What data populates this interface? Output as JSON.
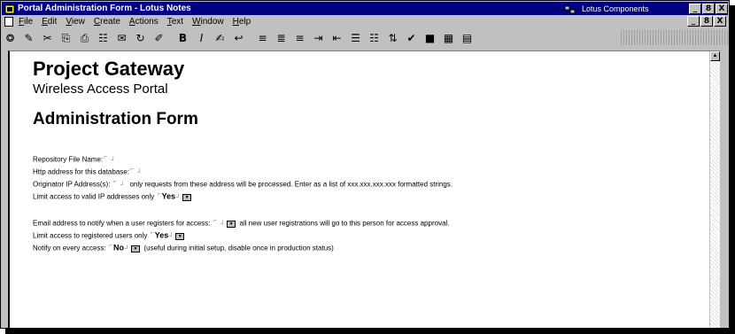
{
  "window": {
    "title": "Portal Administration Form - Lotus Notes",
    "components_label": "Lotus Components",
    "buttons": {
      "minimize": "_",
      "restore": "8",
      "close": "X"
    }
  },
  "menubar": {
    "items": [
      "File",
      "Edit",
      "View",
      "Create",
      "Actions",
      "Text",
      "Window",
      "Help"
    ],
    "buttons": {
      "minimize": "_",
      "restore": "8",
      "close": "X"
    }
  },
  "toolbar": {
    "items": [
      {
        "name": "navigator-icon",
        "glyph": "⭗"
      },
      {
        "name": "edit-doc-icon",
        "glyph": "✎"
      },
      {
        "name": "cut-icon",
        "glyph": "✂"
      },
      {
        "name": "copy-icon",
        "glyph": "⎘"
      },
      {
        "name": "paste-icon",
        "glyph": "⎙"
      },
      {
        "name": "table-icon",
        "glyph": "☷"
      },
      {
        "name": "send-icon",
        "glyph": "✉"
      },
      {
        "name": "refresh-icon",
        "glyph": "↻"
      },
      {
        "name": "attach-icon",
        "glyph": "✐"
      },
      {
        "name": "bold-icon",
        "glyph": "B"
      },
      {
        "name": "italic-icon",
        "glyph": "I"
      },
      {
        "name": "highlight-icon",
        "glyph": "✍"
      },
      {
        "name": "paragraph-style-icon",
        "glyph": "↩"
      },
      {
        "name": "align-left-icon",
        "glyph": "≡"
      },
      {
        "name": "align-center-icon",
        "glyph": "≣"
      },
      {
        "name": "align-right-icon",
        "glyph": "≡"
      },
      {
        "name": "indent-icon",
        "glyph": "⇥"
      },
      {
        "name": "outdent-icon",
        "glyph": "⇤"
      },
      {
        "name": "bullets-icon",
        "glyph": "☰"
      },
      {
        "name": "numbers-icon",
        "glyph": "☷"
      },
      {
        "name": "sort-icon",
        "glyph": "⇅"
      },
      {
        "name": "spellcheck-icon",
        "glyph": "✔"
      },
      {
        "name": "abc-icon",
        "glyph": "■"
      },
      {
        "name": "calendar-icon",
        "glyph": "▦"
      },
      {
        "name": "properties-icon",
        "glyph": "▤"
      }
    ]
  },
  "document": {
    "title": "Project Gateway",
    "subtitle": "Wireless Access Portal",
    "form_heading": "Administration Form",
    "fields": {
      "repository_label": "Repository File Name:",
      "http_label": "Http address for this database:",
      "originator_label": "Originator IP Address(s):",
      "originator_note": "only requests from these address will be processed.  Enter as a list of xxx.xxx.xxx.xxx formatted strings.",
      "limit_ip_label": "Limit access to valid IP addresses only",
      "limit_ip_value": "Yes",
      "email_label": "Email address to notify when a user registers for access:",
      "email_note": "all new user registrations will go to this person for access approval.",
      "limit_reg_label": "Limit access to registered users only",
      "limit_reg_value": "Yes",
      "notify_label": "Notify on every access:",
      "notify_value": "No",
      "notify_note": "(useful during initial setup, disable once in production status)"
    }
  },
  "colors": {
    "titlebar": "#000080",
    "chrome": "#c0c0c0",
    "document": "#ffffff"
  }
}
